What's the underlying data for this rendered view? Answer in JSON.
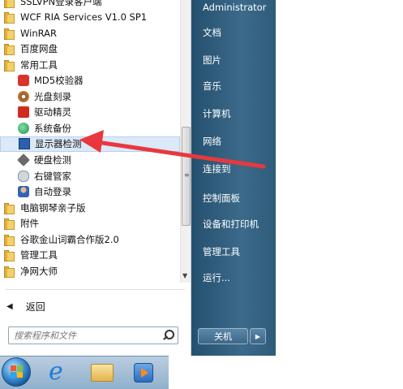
{
  "programs": {
    "items": [
      {
        "label": "SSLVPN登录客户端",
        "icon": "folder-icon",
        "indent": 0
      },
      {
        "label": "WCF RIA Services V1.0 SP1",
        "icon": "folder-icon",
        "indent": 0
      },
      {
        "label": "WinRAR",
        "icon": "folder-icon",
        "indent": 0
      },
      {
        "label": "百度网盘",
        "icon": "folder-icon",
        "indent": 0
      },
      {
        "label": "常用工具",
        "icon": "folder-icon",
        "indent": 0
      },
      {
        "label": "MD5校验器",
        "icon": "md5-icon",
        "indent": 1
      },
      {
        "label": "光盘刻录",
        "icon": "disc-burn-icon",
        "indent": 1
      },
      {
        "label": "驱动精灵",
        "icon": "driver-genius-icon",
        "indent": 1
      },
      {
        "label": "系统备份",
        "icon": "system-backup-icon",
        "indent": 1
      },
      {
        "label": "显示器检测",
        "icon": "monitor-test-icon",
        "indent": 1
      },
      {
        "label": "硬盘检测",
        "icon": "disk-check-icon",
        "indent": 1
      },
      {
        "label": "右键管家",
        "icon": "mouse-icon",
        "indent": 1
      },
      {
        "label": "自动登录",
        "icon": "auto-login-icon",
        "indent": 1
      },
      {
        "label": "电脑钢琴亲子版",
        "icon": "folder-icon",
        "indent": 0
      },
      {
        "label": "附件",
        "icon": "folder-icon",
        "indent": 0
      },
      {
        "label": "谷歌金山词霸合作版2.0",
        "icon": "folder-icon",
        "indent": 0
      },
      {
        "label": "管理工具",
        "icon": "folder-icon",
        "indent": 0
      },
      {
        "label": "净网大师",
        "icon": "folder-icon",
        "indent": 0
      }
    ],
    "highlighted_index": 9
  },
  "back": {
    "label": "返回"
  },
  "search": {
    "placeholder": "搜索程序和文件"
  },
  "right_panel": {
    "items": [
      "Administrator",
      "文档",
      "图片",
      "音乐",
      "计算机",
      "网络",
      "连接到",
      "控制面板",
      "设备和打印机",
      "管理工具",
      "运行..."
    ]
  },
  "power": {
    "label": "关机"
  },
  "colors": {
    "annotation_arrow": "#e8383d",
    "right_panel": "#35617f",
    "highlight": "#dbe9f8"
  }
}
